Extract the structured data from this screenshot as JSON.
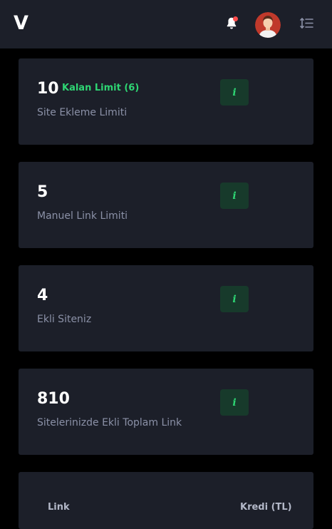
{
  "header": {
    "logo": "V",
    "bell_icon": "bell-icon",
    "menu_icon": "sort-list-icon",
    "bell_dot_color": "#ff4d4d"
  },
  "colors": {
    "accent_green": "#2ed573",
    "info_bg": "#173a2b",
    "card_bg": "#1c1f29"
  },
  "cards": [
    {
      "value": "10",
      "extra": "Kalan Limit (6)",
      "label": "Site Ekleme Limiti",
      "info": "i"
    },
    {
      "value": "5",
      "label": "Manuel Link Limiti",
      "info": "i"
    },
    {
      "value": "4",
      "label": "Ekli Siteniz",
      "info": "i"
    },
    {
      "value": "810",
      "label": "Sitelerinizde Ekli Toplam Link",
      "info": "i"
    }
  ],
  "table": {
    "columns": [
      "Link",
      "Kredi (TL)"
    ]
  }
}
